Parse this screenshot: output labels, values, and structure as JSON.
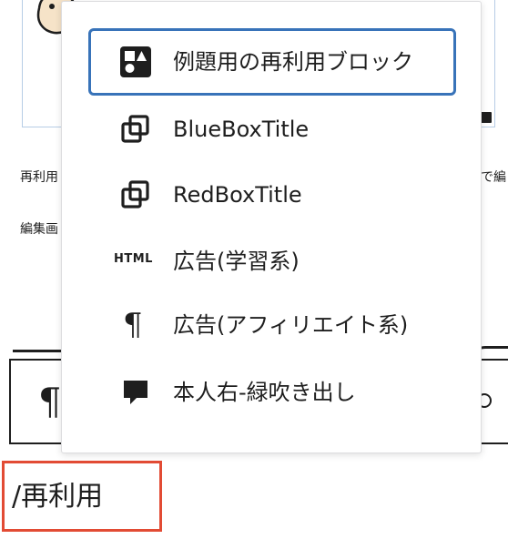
{
  "background": {
    "text_line_1_left": "再利用",
    "text_line_1_right": "で編",
    "text_line_2_left": "編集画",
    "toolbar_paragraph_glyph": "¶"
  },
  "inserter": {
    "typed_query": "/再利用",
    "options": [
      {
        "label": "例題用の再利用ブロック",
        "icon": "reusable-block-icon",
        "selected": true
      },
      {
        "label": "BlueBoxTitle",
        "icon": "reusable-duplicate-icon",
        "selected": false
      },
      {
        "label": "RedBoxTitle",
        "icon": "reusable-duplicate-icon",
        "selected": false
      },
      {
        "label": "広告(学習系)",
        "icon": "html-icon",
        "icon_text": "HTML",
        "selected": false
      },
      {
        "label": "広告(アフィリエイト系)",
        "icon": "paragraph-icon",
        "icon_text": "¶",
        "selected": false
      },
      {
        "label": "本人右-緑吹き出し",
        "icon": "speech-bubble-icon",
        "selected": false
      }
    ]
  },
  "colors": {
    "selection_border": "#3873b9",
    "highlight_box": "#e24b34",
    "image_border": "#b7cde6"
  }
}
